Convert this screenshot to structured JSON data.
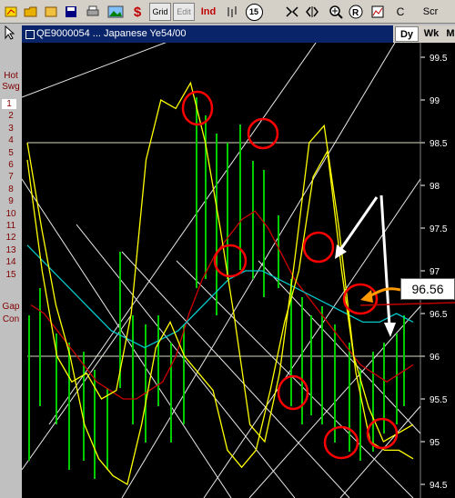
{
  "toolbar": {
    "items": [
      "Grid",
      "Edit",
      "Ind",
      "15",
      "Scr",
      "C",
      "$"
    ]
  },
  "left_panel": {
    "hot_label_1": "Hot",
    "hot_label_2": "Swg",
    "numbers": [
      "1",
      "2",
      "3",
      "4",
      "5",
      "6",
      "7",
      "8",
      "9",
      "10",
      "11",
      "12",
      "13",
      "14",
      "15"
    ],
    "selected": "1",
    "gap_label": "Gap",
    "con_label": "Con"
  },
  "window": {
    "title": "QE9000054 ... Japanese Ye54/00"
  },
  "tabs": [
    "Dy",
    "Wk",
    "M"
  ],
  "price_callout": "96.56",
  "colors": {
    "background": "#000000",
    "price_bars": "#00cc00",
    "moving_avg_red": "#cc0000",
    "moving_avg_cyan": "#00c8c8",
    "envelope": "#ffff00",
    "trendlines": "#ffffff",
    "annotation_circles": "#ff0000",
    "callout_arrow": "#ff9900"
  },
  "chart_data": {
    "type": "line",
    "y_axis_ticks": [
      "99.5",
      "99",
      "98.5",
      "98",
      "97.5",
      "97",
      "96.5",
      "96",
      "95.5",
      "95",
      "94.5"
    ],
    "ylim": [
      94.5,
      99.5
    ],
    "reference_lines": [
      98.5,
      96.0
    ],
    "annotated_value": 96.56,
    "series": [
      {
        "values": [
          96.6,
          96.5,
          96.3,
          96.1,
          95.9,
          95.7,
          95.6,
          95.5,
          95.5,
          95.6,
          95.7,
          96.0,
          96.5,
          96.9,
          97.2,
          97.4,
          97.6,
          97.7,
          97.5,
          97.2,
          96.9,
          96.7,
          96.5,
          96.3,
          96.1,
          95.9,
          95.8,
          95.7,
          95.8,
          95.9
        ]
      },
      {
        "values": [
          97.3,
          97.1,
          96.9,
          96.7,
          96.5,
          96.3,
          96.2,
          96.1,
          96.2,
          96.3,
          96.5,
          96.7,
          96.9,
          97.0,
          97.0,
          96.9,
          96.8,
          96.7,
          96.6,
          96.5,
          96.4,
          96.4,
          96.5,
          96.4
        ]
      },
      {
        "values": [
          98.3,
          97.0,
          96.0,
          95.7,
          95.8,
          95.5,
          95.6,
          96.5,
          98.3,
          99.0,
          98.9,
          99.2,
          98.5,
          97.5,
          96.4,
          95.2,
          95.0,
          95.8,
          97.1,
          98.5,
          98.7,
          97.5,
          96.0,
          95.4,
          95.0,
          95.1,
          95.2
        ]
      },
      {
        "values": [
          98.5,
          97.5,
          96.6,
          96.0,
          95.2,
          94.8,
          94.6,
          94.5,
          95.2,
          96.1,
          96.4,
          96.0,
          95.8,
          95.6,
          94.9,
          94.7,
          94.9,
          95.6,
          96.4,
          97.0,
          98.1,
          98.4,
          97.0,
          95.8,
          95.0,
          94.9,
          94.9,
          94.8
        ]
      }
    ]
  }
}
